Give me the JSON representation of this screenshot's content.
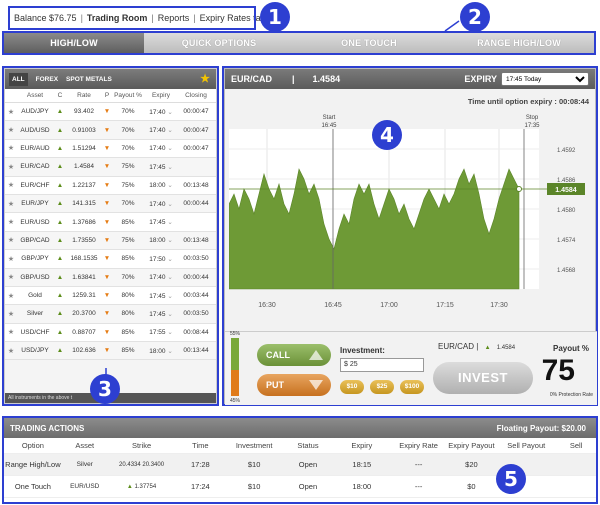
{
  "topbar": {
    "balance": "Balance $76.75",
    "trading_room": "Trading Room",
    "reports": "Reports",
    "expiry_table": "Expiry Rates table"
  },
  "tabs": [
    "HIGH/LOW",
    "QUICK OPTIONS",
    "ONE TOUCH",
    "RANGE HIGH/LOW"
  ],
  "callouts": [
    "1",
    "2",
    "3",
    "4",
    "5"
  ],
  "filters": [
    "ALL",
    "FOREX",
    "SPOT METALS"
  ],
  "asset_table": {
    "headers": [
      "Asset",
      "C",
      "Rate",
      "P",
      "Payout %",
      "Expiry",
      "Closing"
    ],
    "rows": [
      {
        "asset": "AUD/JPY",
        "rate": "93.402",
        "payout": "70%",
        "expiry": "17:40",
        "closing": "00:00:47"
      },
      {
        "asset": "AUD/USD",
        "rate": "0.91003",
        "payout": "70%",
        "expiry": "17:40",
        "closing": "00:00:47"
      },
      {
        "asset": "EUR/AUD",
        "rate": "1.51294",
        "payout": "70%",
        "expiry": "17:40",
        "closing": "00:00:47"
      },
      {
        "asset": "EUR/CAD",
        "rate": "1.4584",
        "payout": "75%",
        "expiry": "17:45",
        "closing": ""
      },
      {
        "asset": "EUR/CHF",
        "rate": "1.22137",
        "payout": "75%",
        "expiry": "18:00",
        "closing": "00:13:48"
      },
      {
        "asset": "EUR/JPY",
        "rate": "141.315",
        "payout": "70%",
        "expiry": "17:40",
        "closing": "00:00:44"
      },
      {
        "asset": "EUR/USD",
        "rate": "1.37686",
        "payout": "85%",
        "expiry": "17:45",
        "closing": ""
      },
      {
        "asset": "GBP/CAD",
        "rate": "1.73550",
        "payout": "75%",
        "expiry": "18:00",
        "closing": "00:13:48"
      },
      {
        "asset": "GBP/JPY",
        "rate": "168.1535",
        "payout": "85%",
        "expiry": "17:50",
        "closing": "00:03:50"
      },
      {
        "asset": "GBP/USD",
        "rate": "1.63841",
        "payout": "70%",
        "expiry": "17:40",
        "closing": "00:00:44"
      },
      {
        "asset": "Gold",
        "rate": "1259.31",
        "payout": "80%",
        "expiry": "17:45",
        "closing": "00:03:44"
      },
      {
        "asset": "Silver",
        "rate": "20.3700",
        "payout": "80%",
        "expiry": "17:45",
        "closing": "00:03:50"
      },
      {
        "asset": "USD/CHF",
        "rate": "0.88707",
        "payout": "85%",
        "expiry": "17:55",
        "closing": "00:08:44"
      },
      {
        "asset": "USD/JPY",
        "rate": "102.636",
        "payout": "85%",
        "expiry": "18:00",
        "closing": "00:13:44"
      }
    ],
    "footer": "All instruments in the above t"
  },
  "chart_panel": {
    "pair": "EUR/CAD",
    "rate": "1.4584",
    "expiry_label": "EXPIRY",
    "expiry_select": "17:45 Today",
    "timer": "Time until option expiry : 00:08:44",
    "start_label": "Start",
    "start_time": "16:45",
    "stop_label": "Stop",
    "stop_time": "17:35",
    "current_tag": "1.4584",
    "pct_top": "55%",
    "pct_bottom": "45%",
    "call": "CALL",
    "put": "PUT",
    "investment_label": "Investment:",
    "investment_value": "$  25",
    "chips": [
      "$10",
      "$25",
      "$100"
    ],
    "pair_small": "EUR/CAD",
    "rate_small": "1.4584",
    "invest_button": "INVEST",
    "payout_label": "Payout %",
    "payout_value": "75",
    "protection": "0% Protection Rate"
  },
  "chart_data": {
    "type": "area",
    "x_ticks": [
      "16:30",
      "16:45",
      "17:00",
      "17:15",
      "17:30"
    ],
    "y_ticks": [
      "1.4592",
      "1.4586",
      "1.4580",
      "1.4574",
      "1.4568"
    ],
    "y_range": [
      1.4564,
      1.4596
    ],
    "current_value": 1.4584,
    "series_values": [
      1.4581,
      1.4583,
      1.458,
      1.4584,
      1.4582,
      1.4579,
      1.4583,
      1.4587,
      1.4584,
      1.4582,
      1.4585,
      1.4581,
      1.4579,
      1.4583,
      1.4588,
      1.4586,
      1.4583,
      1.4585,
      1.4582,
      1.4577,
      1.4574,
      1.4572,
      1.4576,
      1.4579,
      1.4577,
      1.4582,
      1.4585,
      1.4583,
      1.4585,
      1.4581,
      1.4578,
      1.4581,
      1.4584,
      1.4582,
      1.4579,
      1.4581,
      1.4578,
      1.4576,
      1.4579,
      1.4582,
      1.4584,
      1.4582,
      1.458,
      1.4583,
      1.4581,
      1.4583,
      1.4586,
      1.4588,
      1.4585,
      1.4587,
      1.4583,
      1.4578,
      1.4575,
      1.4578,
      1.4582,
      1.4585,
      1.4588,
      1.4586,
      1.4584
    ]
  },
  "trading_actions": {
    "title": "TRADING ACTIONS",
    "floating_payout": "Floating Payout:  $20.00",
    "headers": [
      "Option",
      "Asset",
      "Strike",
      "Time",
      "Investment",
      "Status",
      "Expiry",
      "Expiry Rate",
      "Expiry Payout",
      "Sell Payout",
      "Sell"
    ],
    "rows": [
      {
        "option": "Range High/Low",
        "asset": "Silver",
        "strike": "20.4334 20.3400",
        "time": "17:28",
        "investment": "$10",
        "status": "Open",
        "expiry": "18:15",
        "rate": "---",
        "payout": "$20"
      },
      {
        "option": "One Touch",
        "asset": "EUR/USD",
        "strike": "1.37754",
        "time": "17:24",
        "investment": "$10",
        "status": "Open",
        "expiry": "18:00",
        "rate": "---",
        "payout": "$0"
      }
    ]
  },
  "colors": {
    "callout": "#2d3fd1",
    "up": "#5c8d1a",
    "down": "#e57b12",
    "area": "#6e9a36"
  }
}
